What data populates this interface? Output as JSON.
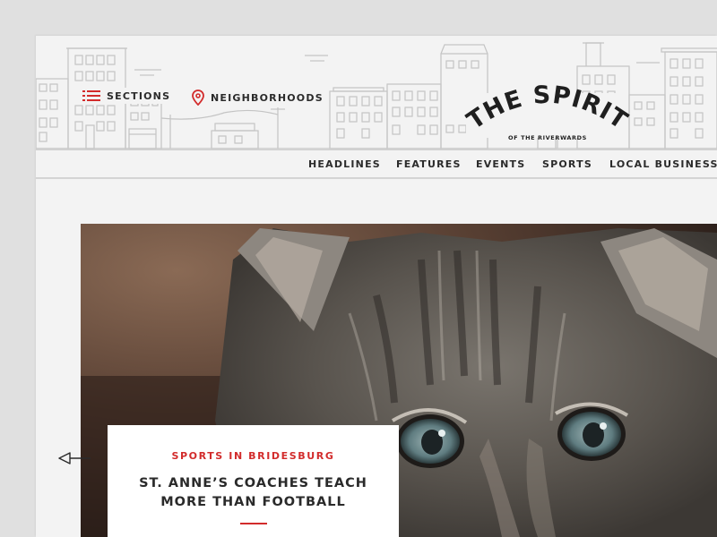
{
  "header": {
    "sections_label": "SECTIONS",
    "neighborhoods_label": "NEIGHBORHOODS",
    "logo": {
      "title": "THE SPIRIT",
      "tagline": "OF THE RIVERWARDS"
    }
  },
  "subnav": {
    "items": [
      {
        "label": "HEADLINES"
      },
      {
        "label": "FEATURES"
      },
      {
        "label": "EVENTS"
      },
      {
        "label": "SPORTS"
      },
      {
        "label": "LOCAL BUSINESS"
      }
    ]
  },
  "featured": {
    "kicker": "SPORTS IN BRIDESBURG",
    "title": "ST. ANNE’S COACHES TEACH MORE THAN FOOTBALL"
  },
  "colors": {
    "accent": "#d22b2b",
    "text": "#2b2b2b",
    "background": "#f3f3f3"
  },
  "icons": {
    "sections": "menu-list-icon",
    "neighborhoods": "map-pin-icon",
    "prev": "arrow-left-icon"
  }
}
